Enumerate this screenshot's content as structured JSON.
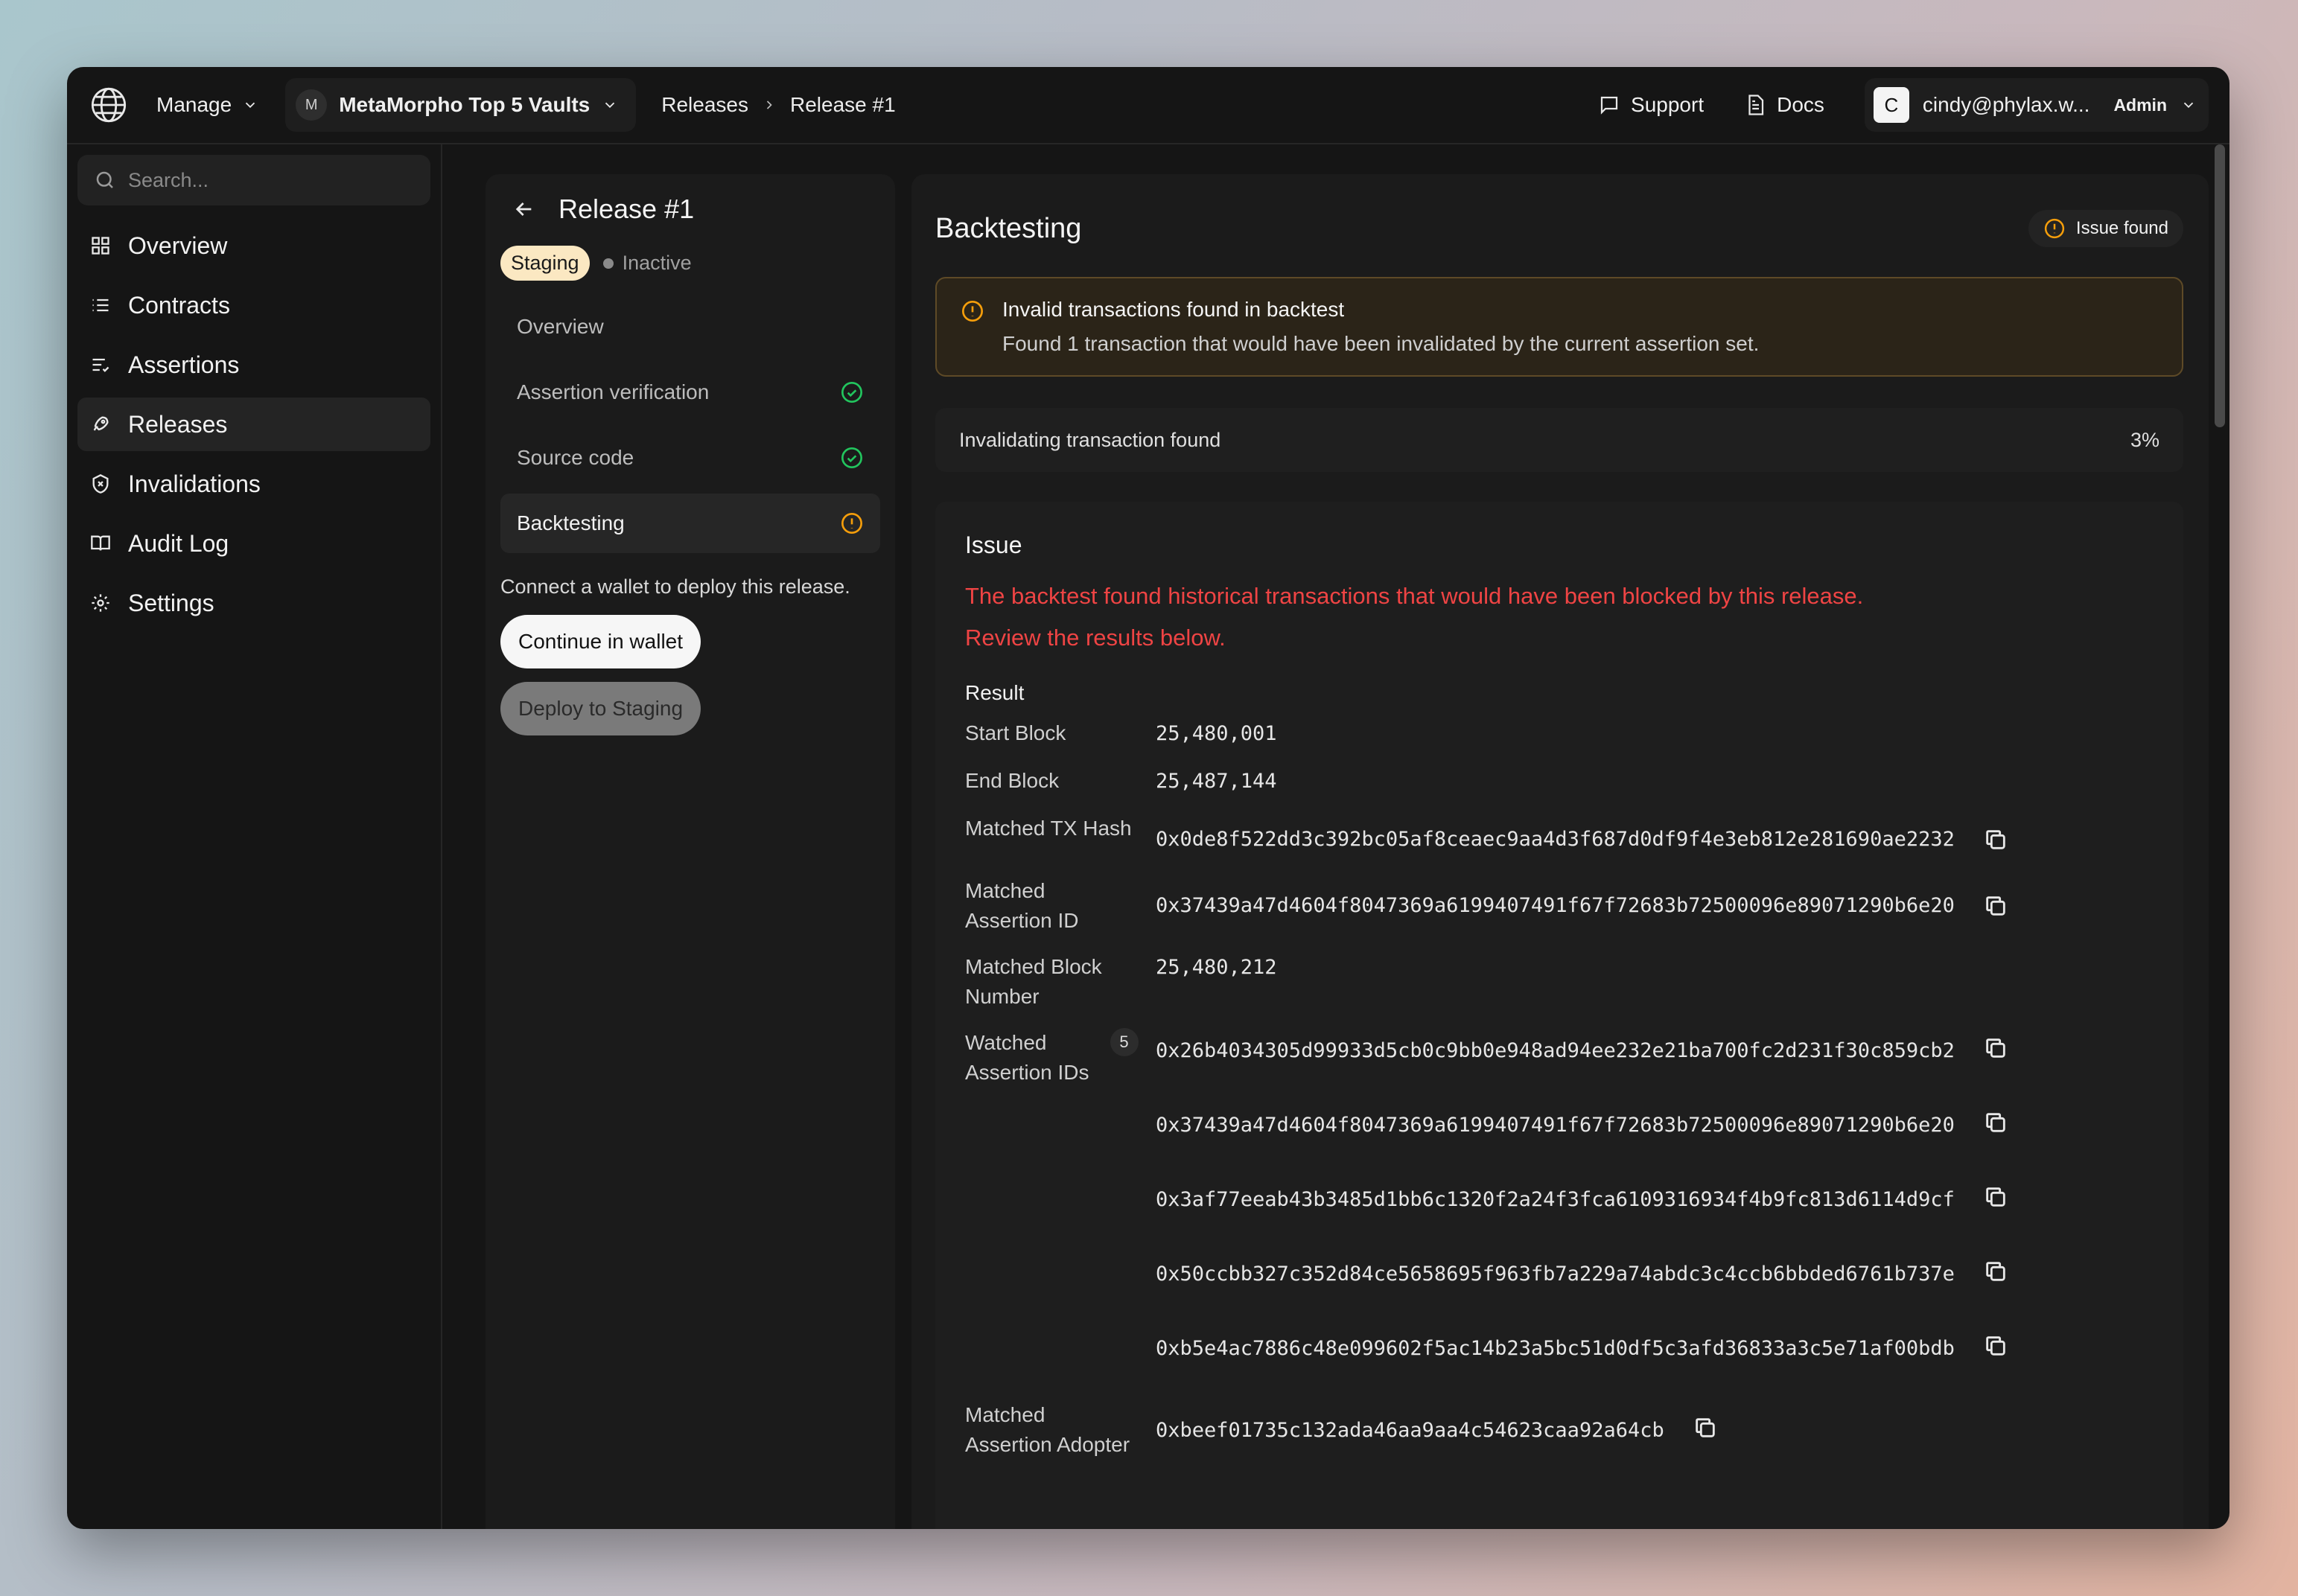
{
  "topbar": {
    "manage_label": "Manage",
    "project_initial": "M",
    "project_name": "MetaMorpho Top 5 Vaults",
    "breadcrumb": [
      "Releases",
      "Release #1"
    ],
    "support_label": "Support",
    "docs_label": "Docs",
    "user_initial": "C",
    "user_email": "cindy@phylax.w...",
    "user_role": "Admin"
  },
  "sidebar": {
    "search_placeholder": "Search...",
    "items": [
      {
        "label": "Overview",
        "icon": "grid-icon"
      },
      {
        "label": "Contracts",
        "icon": "list-icon"
      },
      {
        "label": "Assertions",
        "icon": "list-check-icon"
      },
      {
        "label": "Releases",
        "icon": "rocket-icon",
        "active": true
      },
      {
        "label": "Invalidations",
        "icon": "shield-x-icon"
      },
      {
        "label": "Audit Log",
        "icon": "book-open-icon"
      },
      {
        "label": "Settings",
        "icon": "gear-icon"
      }
    ]
  },
  "release": {
    "title": "Release #1",
    "environment": "Staging",
    "state": "Inactive",
    "steps": [
      {
        "label": "Overview",
        "status": "none"
      },
      {
        "label": "Assertion verification",
        "status": "success"
      },
      {
        "label": "Source code",
        "status": "success"
      },
      {
        "label": "Backtesting",
        "status": "warning",
        "active": true
      }
    ],
    "deploy_note": "Connect a wallet to deploy this release.",
    "continue_label": "Continue in wallet",
    "deploy_label": "Deploy to Staging"
  },
  "backtesting": {
    "title": "Backtesting",
    "badge": "Issue found",
    "alert_title": "Invalid transactions found in backtest",
    "alert_text": "Found 1 transaction that would have been invalidated by the current assertion set.",
    "progress_label": "Invalidating transaction found",
    "progress_value": "3%",
    "issue_title": "Issue",
    "issue_line1": "The backtest found historical transactions that would have been blocked by this release.",
    "issue_line2": "Review the results below.",
    "result_title": "Result",
    "start_block_label": "Start Block",
    "start_block": "25,480,001",
    "end_block_label": "End Block",
    "end_block": "25,487,144",
    "tx_hash_label": "Matched TX Hash",
    "tx_hash": "0x0de8f522dd3c392bc05af8ceaec9aa4d3f687d0df9f4e3eb812e281690ae2232",
    "assertion_id_label_1": "Matched",
    "assertion_id_label_2": "Assertion ID",
    "assertion_id": "0x37439a47d4604f8047369a6199407491f67f72683b72500096e89071290b6e20",
    "block_number_label_1": "Matched Block",
    "block_number_label_2": "Number",
    "block_number": "25,480,212",
    "watched_label_1": "Watched",
    "watched_label_2": "Assertion IDs",
    "watched_count": "5",
    "watched_ids": [
      "0x26b4034305d99933d5cb0c9bb0e948ad94ee232e21ba700fc2d231f30c859cb2",
      "0x37439a47d4604f8047369a6199407491f67f72683b72500096e89071290b6e20",
      "0x3af77eeab43b3485d1bb6c1320f2a24f3fca6109316934f4b9fc813d6114d9cf",
      "0x50ccbb327c352d84ce5658695f963fb7a229a74abdc3c4ccb6bbded6761b737e",
      "0xb5e4ac7886c48e099602f5ac14b23a5bc51d0df5c3afd36833a3c5e71af00bdb"
    ],
    "adopter_label_1": "Matched",
    "adopter_label_2": "Assertion Adopter",
    "adopter": "0xbeef01735c132ada46aa9aa4c54623caa92a64cb"
  },
  "colors": {
    "warning": "#f59e0b",
    "success": "#22c55e",
    "error_text": "#ef4444",
    "staging_pill": "#fbe8c2"
  }
}
